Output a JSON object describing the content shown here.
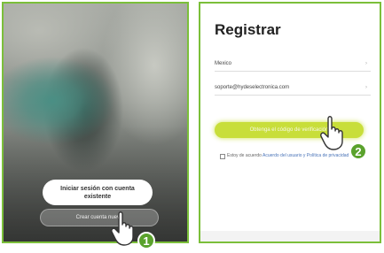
{
  "login_screen": {
    "login_button": "Iniciar sesión con cuenta existente",
    "create_account_button": "Crear cuenta nueva"
  },
  "register_screen": {
    "title": "Registrar",
    "country": "Mexico",
    "email": "soporte@hydeselectronica.com",
    "get_code_button": "Obtenga el código de verificación",
    "agree_text": "Estoy de acuerdo ",
    "agree_link": "Acuerdo del usuario y Política de privacidad"
  },
  "steps": {
    "step1": "1",
    "step2": "2"
  },
  "colors": {
    "accent": "#7bbf3a",
    "button_lime": "#c8de3a",
    "badge": "#5aa22c"
  },
  "icons": {
    "hand": "hand-pointer-icon",
    "chevron": "chevron-right-icon"
  }
}
